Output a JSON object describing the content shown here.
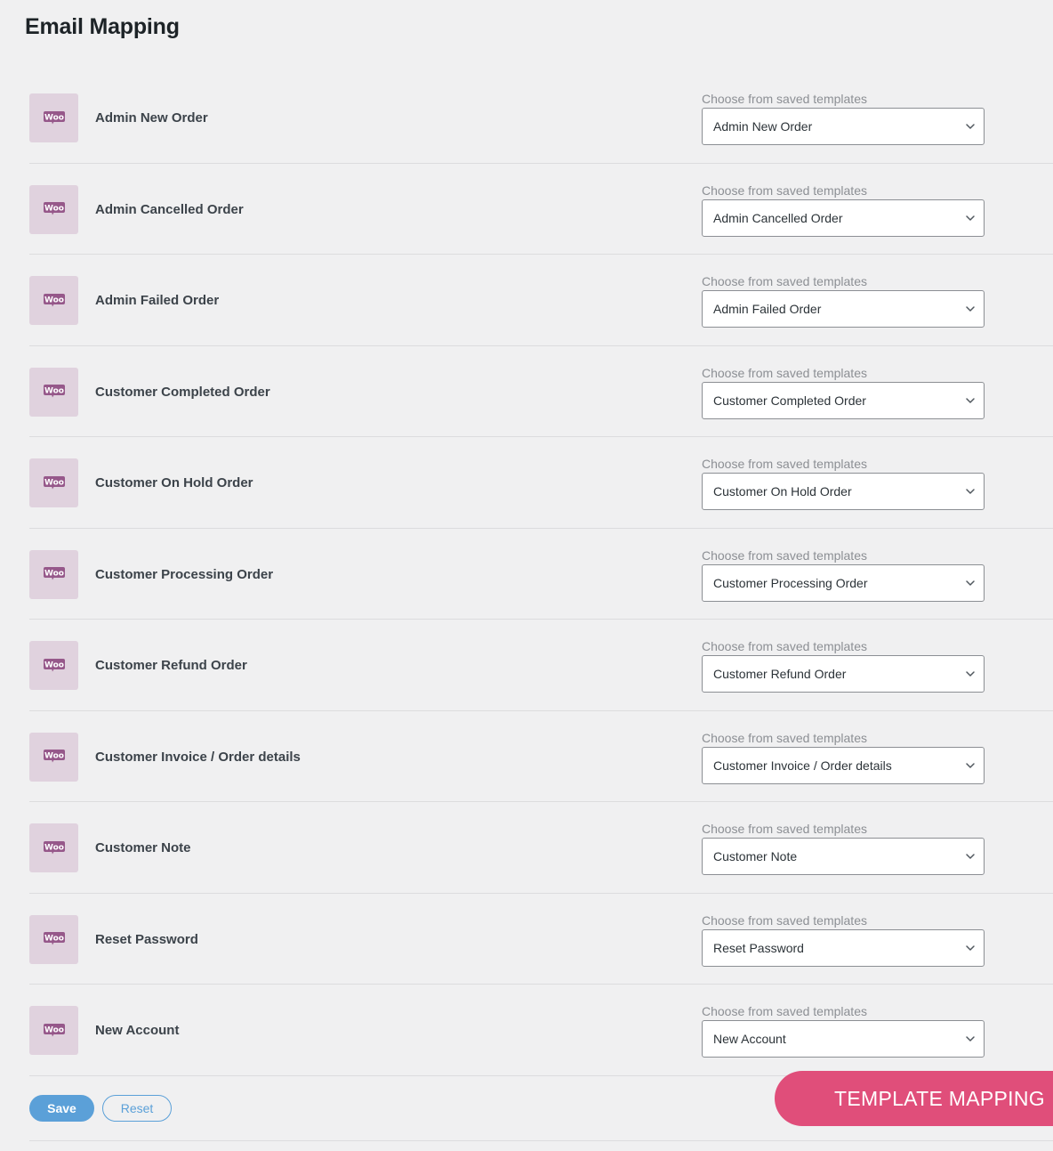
{
  "page": {
    "title": "Email Mapping"
  },
  "select_caption": "Choose from saved templates",
  "icon": "woocommerce-logo-icon",
  "colors": {
    "background": "#f0f0f1",
    "woo_tile": "#e0d2de",
    "woo_purple": "#96588a",
    "primary_button": "#5ba0d8",
    "banner": "#e04e7a"
  },
  "rows": [
    {
      "label": "Admin New Order",
      "selected": "Admin New Order"
    },
    {
      "label": "Admin Cancelled Order",
      "selected": "Admin Cancelled Order"
    },
    {
      "label": "Admin Failed Order",
      "selected": "Admin Failed Order"
    },
    {
      "label": "Customer Completed Order",
      "selected": "Customer Completed Order"
    },
    {
      "label": "Customer On Hold Order",
      "selected": "Customer On Hold Order"
    },
    {
      "label": "Customer Processing Order",
      "selected": "Customer Processing Order"
    },
    {
      "label": "Customer Refund Order",
      "selected": "Customer Refund Order"
    },
    {
      "label": "Customer Invoice / Order details",
      "selected": "Customer Invoice / Order details"
    },
    {
      "label": "Customer Note",
      "selected": "Customer Note"
    },
    {
      "label": "Reset Password",
      "selected": "Reset Password"
    },
    {
      "label": "New Account",
      "selected": "New Account"
    }
  ],
  "actions": {
    "save_label": "Save",
    "reset_label": "Reset"
  },
  "banner": {
    "label": "TEMPLATE MAPPING"
  }
}
